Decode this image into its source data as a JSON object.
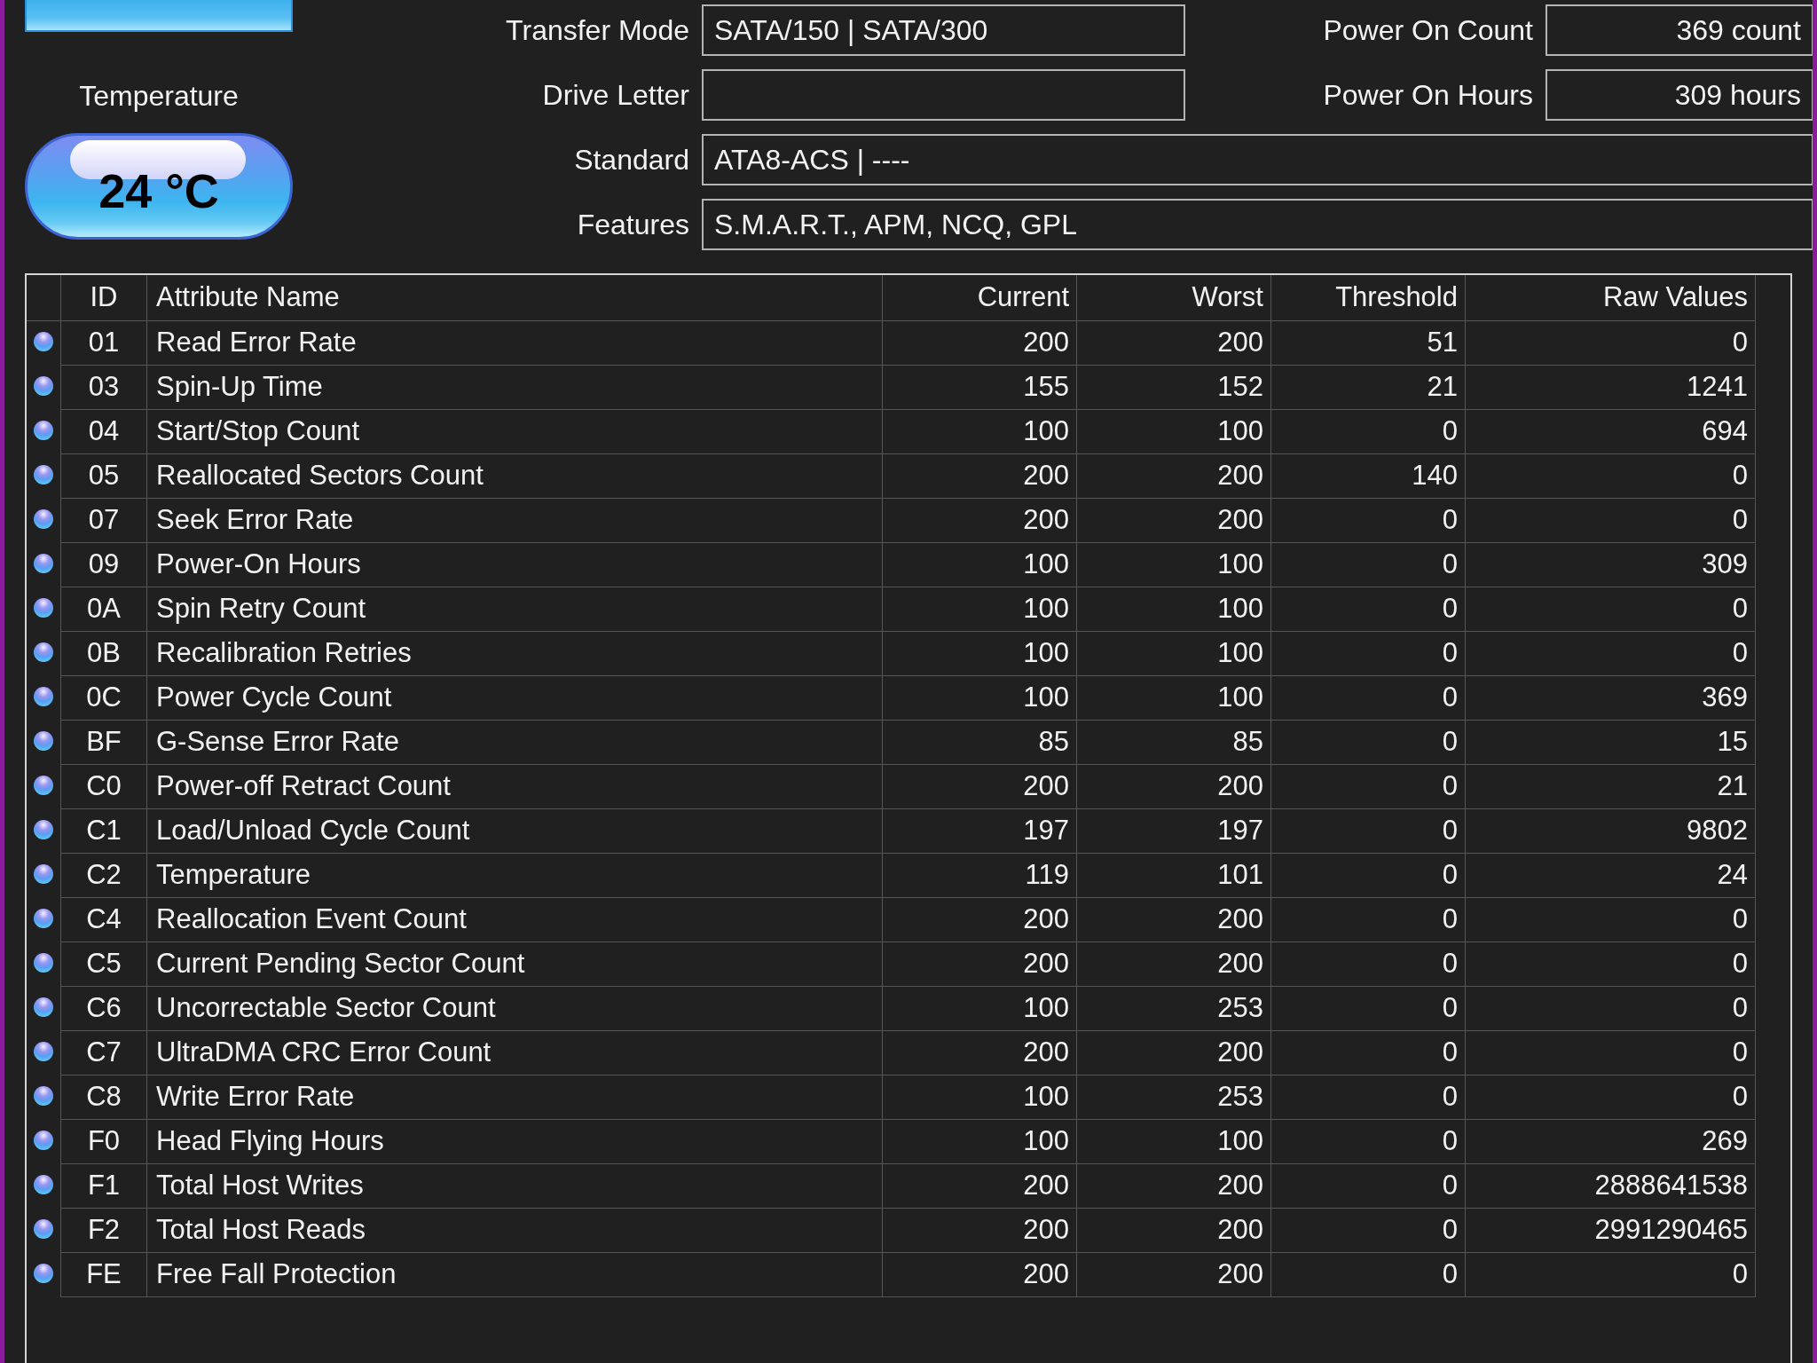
{
  "status_panel": {
    "healthy": true
  },
  "temperature": {
    "label": "Temperature",
    "value": "24 °C",
    "healthy": true
  },
  "drive_info": [
    {
      "label": "Transfer Mode",
      "value": "SATA/150 | SATA/300"
    },
    {
      "label": "Drive Letter"
    },
    {
      "label": "Standard",
      "value": "ATA8-ACS | ----"
    },
    {
      "label": "Features",
      "value": "S.M.A.R.T., APM, NCQ, GPL"
    }
  ],
  "counters": [
    {
      "label": "Power On Count",
      "value": "369 count"
    },
    {
      "label": "Power On Hours",
      "value": "309 hours"
    }
  ],
  "table": {
    "columns": [
      "ID",
      "Attribute Name",
      "Current",
      "Worst",
      "Threshold",
      "Raw Values"
    ],
    "rows": [
      {
        "healthy": true,
        "id": "01",
        "name": "Read Error Rate",
        "current": "200",
        "worst": "200",
        "threshold": "51",
        "raw_value": "0"
      },
      {
        "healthy": true,
        "id": "03",
        "name": "Spin-Up Time",
        "current": "155",
        "worst": "152",
        "threshold": "21",
        "raw_value": "1241"
      },
      {
        "healthy": true,
        "id": "04",
        "name": "Start/Stop Count",
        "current": "100",
        "worst": "100",
        "threshold": "0",
        "raw_value": "694"
      },
      {
        "healthy": true,
        "id": "05",
        "name": "Reallocated Sectors Count",
        "current": "200",
        "worst": "200",
        "threshold": "140",
        "raw_value": "0"
      },
      {
        "healthy": true,
        "id": "07",
        "name": "Seek Error Rate",
        "current": "200",
        "worst": "200",
        "threshold": "0",
        "raw_value": "0"
      },
      {
        "healthy": true,
        "id": "09",
        "name": "Power-On Hours",
        "current": "100",
        "worst": "100",
        "threshold": "0",
        "raw_value": "309"
      },
      {
        "healthy": true,
        "id": "0A",
        "name": "Spin Retry Count",
        "current": "100",
        "worst": "100",
        "threshold": "0",
        "raw_value": "0"
      },
      {
        "healthy": true,
        "id": "0B",
        "name": "Recalibration Retries",
        "current": "100",
        "worst": "100",
        "threshold": "0",
        "raw_value": "0"
      },
      {
        "healthy": true,
        "id": "0C",
        "name": "Power Cycle Count",
        "current": "100",
        "worst": "100",
        "threshold": "0",
        "raw_value": "369"
      },
      {
        "healthy": true,
        "id": "BF",
        "name": "G-Sense Error Rate",
        "current": "85",
        "worst": "85",
        "threshold": "0",
        "raw_value": "15"
      },
      {
        "healthy": true,
        "id": "C0",
        "name": "Power-off Retract Count",
        "current": "200",
        "worst": "200",
        "threshold": "0",
        "raw_value": "21"
      },
      {
        "healthy": true,
        "id": "C1",
        "name": "Load/Unload Cycle Count",
        "current": "197",
        "worst": "197",
        "threshold": "0",
        "raw_value": "9802"
      },
      {
        "healthy": true,
        "id": "C2",
        "name": "Temperature",
        "current": "119",
        "worst": "101",
        "threshold": "0",
        "raw_value": "24"
      },
      {
        "healthy": true,
        "id": "C4",
        "name": "Reallocation Event Count",
        "current": "200",
        "worst": "200",
        "threshold": "0",
        "raw_value": "0"
      },
      {
        "healthy": true,
        "id": "C5",
        "name": "Current Pending Sector Count",
        "current": "200",
        "worst": "200",
        "threshold": "0",
        "raw_value": "0"
      },
      {
        "healthy": true,
        "id": "C6",
        "name": "Uncorrectable Sector Count",
        "current": "100",
        "worst": "253",
        "threshold": "0",
        "raw_value": "0"
      },
      {
        "healthy": true,
        "id": "C7",
        "name": "UltraDMA CRC Error Count",
        "current": "200",
        "worst": "200",
        "threshold": "0",
        "raw_value": "0"
      },
      {
        "healthy": true,
        "id": "C8",
        "name": "Write Error Rate",
        "current": "100",
        "worst": "253",
        "threshold": "0",
        "raw_value": "0"
      },
      {
        "healthy": true,
        "id": "F0",
        "name": "Head Flying Hours",
        "current": "100",
        "worst": "100",
        "threshold": "0",
        "raw_value": "269"
      },
      {
        "healthy": true,
        "id": "F1",
        "name": "Total Host Writes",
        "current": "200",
        "worst": "200",
        "threshold": "0",
        "raw_value": "2888641538"
      },
      {
        "healthy": true,
        "id": "F2",
        "name": "Total Host Reads",
        "current": "200",
        "worst": "200",
        "threshold": "0",
        "raw_value": "2991290465"
      },
      {
        "healthy": true,
        "id": "FE",
        "name": "Free Fall Protection",
        "current": "200",
        "worst": "200",
        "threshold": "0",
        "raw_value": "0"
      }
    ]
  }
}
